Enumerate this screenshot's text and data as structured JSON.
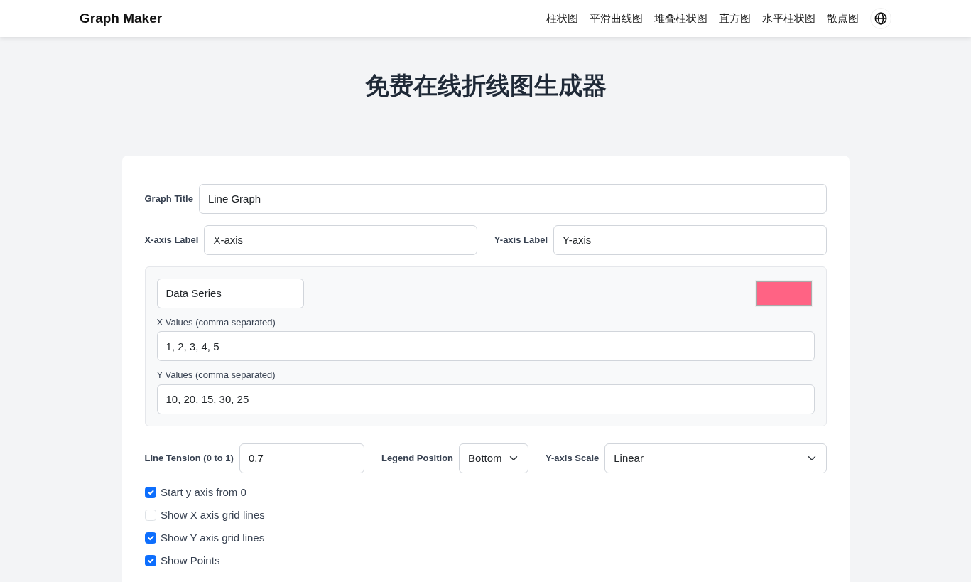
{
  "navbar": {
    "brand": "Graph Maker",
    "links": [
      {
        "label": "柱状图"
      },
      {
        "label": "平滑曲线图"
      },
      {
        "label": "堆叠柱状图"
      },
      {
        "label": "直方图"
      },
      {
        "label": "水平柱状图"
      },
      {
        "label": "散点图"
      }
    ]
  },
  "heading": "免费在线折线图生成器",
  "form": {
    "graph_title": {
      "label": "Graph Title",
      "value": "Line Graph"
    },
    "x_axis": {
      "label": "X-axis Label",
      "value": "X-axis"
    },
    "y_axis": {
      "label": "Y-axis Label",
      "value": "Y-axis"
    },
    "series": {
      "name": "Data Series",
      "color": "#ff6384",
      "x_label": "X Values (comma separated)",
      "x_values": "1, 2, 3, 4, 5",
      "y_label": "Y Values (comma separated)",
      "y_values": "10, 20, 15, 30, 25"
    },
    "tension": {
      "label": "Line Tension (0 to 1)",
      "value": "0.7"
    },
    "legend": {
      "label": "Legend Position",
      "value": "Bottom"
    },
    "scale": {
      "label": "Y-axis Scale",
      "value": "Linear"
    },
    "options": [
      {
        "label": "Start y axis from 0",
        "checked": true
      },
      {
        "label": "Show X axis grid lines",
        "checked": false
      },
      {
        "label": "Show Y axis grid lines",
        "checked": true
      },
      {
        "label": "Show Points",
        "checked": true
      }
    ]
  }
}
